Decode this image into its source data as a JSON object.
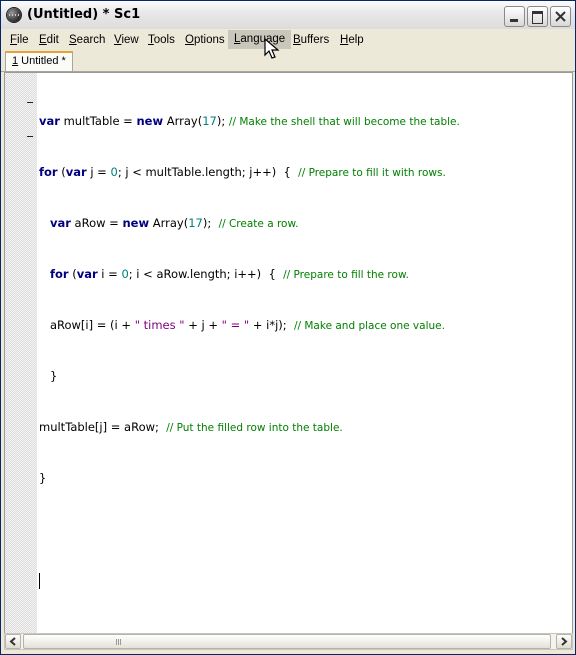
{
  "window": {
    "title": "(Untitled) * Sc1"
  },
  "menu": {
    "items": [
      {
        "key": "F",
        "rest": "ile"
      },
      {
        "key": "E",
        "rest": "dit"
      },
      {
        "key": "S",
        "rest": "earch"
      },
      {
        "key": "V",
        "rest": "iew"
      },
      {
        "key": "T",
        "rest": "ools"
      },
      {
        "key": "O",
        "rest": "ptions"
      },
      {
        "key": "L",
        "rest": "anguage"
      },
      {
        "key": "B",
        "rest": "uffers"
      },
      {
        "key": "H",
        "rest": "elp"
      }
    ]
  },
  "tabs": [
    {
      "num": "1",
      "label": " Untitled *"
    }
  ],
  "code": {
    "l1": {
      "kw1": "var",
      "t1": " multTable = ",
      "kw2": "new",
      "t2": " Array(",
      "num": "17",
      "t3": ");",
      "com": "// Make the shell that will become the table."
    },
    "l2": {
      "kw1": "for",
      "t1": " (",
      "kw2": "var",
      "t2": " j = ",
      "num": "0",
      "t3": "; j < multTable.length; j++)  {",
      "com": "// Prepare to fill it with rows."
    },
    "l3": {
      "kw1": "var",
      "t1": " aRow = ",
      "kw2": "new",
      "t2": " Array(",
      "num": "17",
      "t3": ");",
      "com": "// Create a row."
    },
    "l4": {
      "kw1": "for",
      "t1": " (",
      "kw2": "var",
      "t2": " i = ",
      "num": "0",
      "t3": "; i < aRow.length; i++)  {",
      "com": "// Prepare to fill the row."
    },
    "l5": {
      "t1": "aRow[i] = (i + ",
      "s1": "\" times \"",
      "t2": " + j + ",
      "s2": "\" = \"",
      "t3": " + i*j);",
      "com": "// Make and place one value."
    },
    "l6": {
      "t1": "}"
    },
    "l7": {
      "t1": "multTable[j] = aRow;",
      "com": "// Put the filled row into the table."
    },
    "l8": {
      "t1": "}"
    }
  },
  "icons": {
    "app": "app-icon",
    "cursor": "mouse-pointer-icon"
  }
}
